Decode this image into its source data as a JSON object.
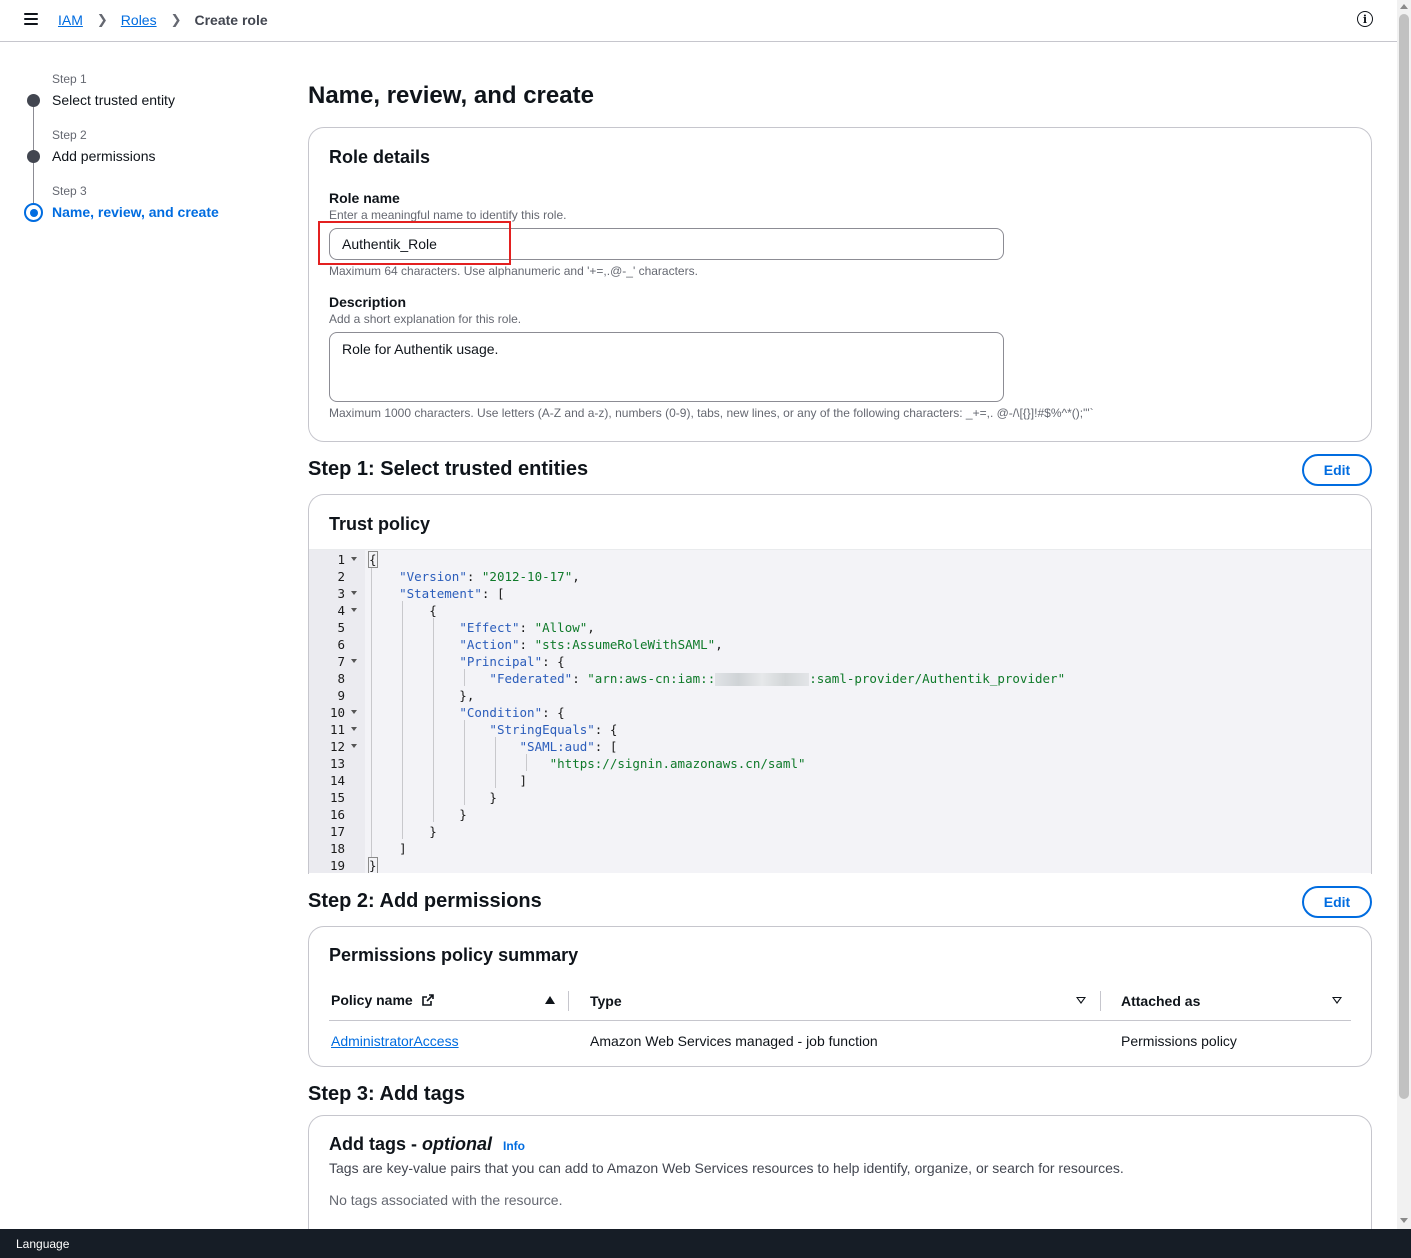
{
  "breadcrumb": {
    "items": [
      "IAM",
      "Roles"
    ],
    "current": "Create role"
  },
  "sidenav": {
    "steps": [
      {
        "label": "Step 1",
        "title": "Select trusted entity"
      },
      {
        "label": "Step 2",
        "title": "Add permissions"
      },
      {
        "label": "Step 3",
        "title": "Name, review, and create"
      }
    ]
  },
  "page": {
    "title": "Name, review, and create"
  },
  "role_details": {
    "title": "Role details",
    "name_label": "Role name",
    "name_desc": "Enter a meaningful name to identify this role.",
    "name_value": "Authentik_Role",
    "name_constraint": "Maximum 64 characters. Use alphanumeric and '+=,.@-_' characters.",
    "desc_label": "Description",
    "desc_desc": "Add a short explanation for this role.",
    "desc_value": "Role for Authentik usage.",
    "desc_constraint": "Maximum 1000 characters. Use letters (A-Z and a-z), numbers (0-9), tabs, new lines, or any of the following characters: _+=,. @-/\\[{}]!#$%^*();\"'`"
  },
  "step1": {
    "title": "Step 1: Select trusted entities",
    "edit_label": "Edit",
    "card_title": "Trust policy",
    "code": {
      "version_key": "\"Version\"",
      "version_val": "\"2012-10-17\"",
      "statement_key": "\"Statement\"",
      "effect_key": "\"Effect\"",
      "effect_val": "\"Allow\"",
      "action_key": "\"Action\"",
      "action_val": "\"sts:AssumeRoleWithSAML\"",
      "principal_key": "\"Principal\"",
      "federated_key": "\"Federated\"",
      "federated_val_start": "\"arn:aws-cn:iam::",
      "federated_val_end": ":saml-provider/Authentik_provider\"",
      "condition_key": "\"Condition\"",
      "stringequals_key": "\"StringEquals\"",
      "samlaud_key": "\"SAML:aud\"",
      "samlaud_val": "\"https://signin.amazonaws.cn/saml\""
    }
  },
  "step2": {
    "title": "Step 2: Add permissions",
    "edit_label": "Edit",
    "card_title": "Permissions policy summary",
    "columns": [
      "Policy name",
      "Type",
      "Attached as"
    ],
    "rows": [
      {
        "policy": "AdministratorAccess",
        "type": "Amazon Web Services managed - job function",
        "attached": "Permissions policy"
      }
    ]
  },
  "step3": {
    "title": "Step 3: Add tags",
    "card_title": "Add tags - ",
    "card_title_optional": "optional",
    "info_label": "Info",
    "desc": "Tags are key-value pairs that you can add to Amazon Web Services resources to help identify, organize, or search for resources.",
    "empty": "No tags associated with the resource."
  },
  "footer": {
    "language": "Language"
  },
  "colors": {
    "accent": "#006ce0",
    "highlight": "#e32020",
    "footer_bg": "#161d26"
  }
}
